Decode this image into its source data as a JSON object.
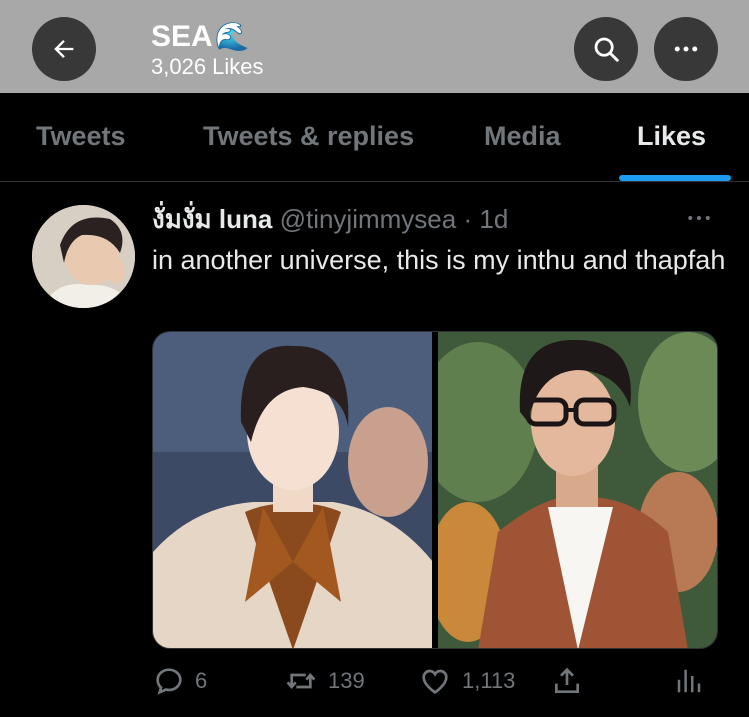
{
  "header": {
    "title": "SEA",
    "title_emoji": "🌊",
    "subtitle": "3,026 Likes"
  },
  "tabs": [
    {
      "label": "Tweets"
    },
    {
      "label": "Tweets & replies"
    },
    {
      "label": "Media"
    },
    {
      "label": "Likes"
    }
  ],
  "tweet": {
    "name": "งั่มงั่ม luna",
    "handle": "@tinyjimmysea",
    "separator": "·",
    "time": "1d",
    "text": "in another universe, this is my inthu and thapfah",
    "stats": {
      "replies": "6",
      "retweets": "139",
      "likes": "1,113"
    }
  },
  "colors": {
    "header_bg": "#a8a8a8",
    "accent": "#1d9bf0",
    "muted": "#71767b"
  }
}
